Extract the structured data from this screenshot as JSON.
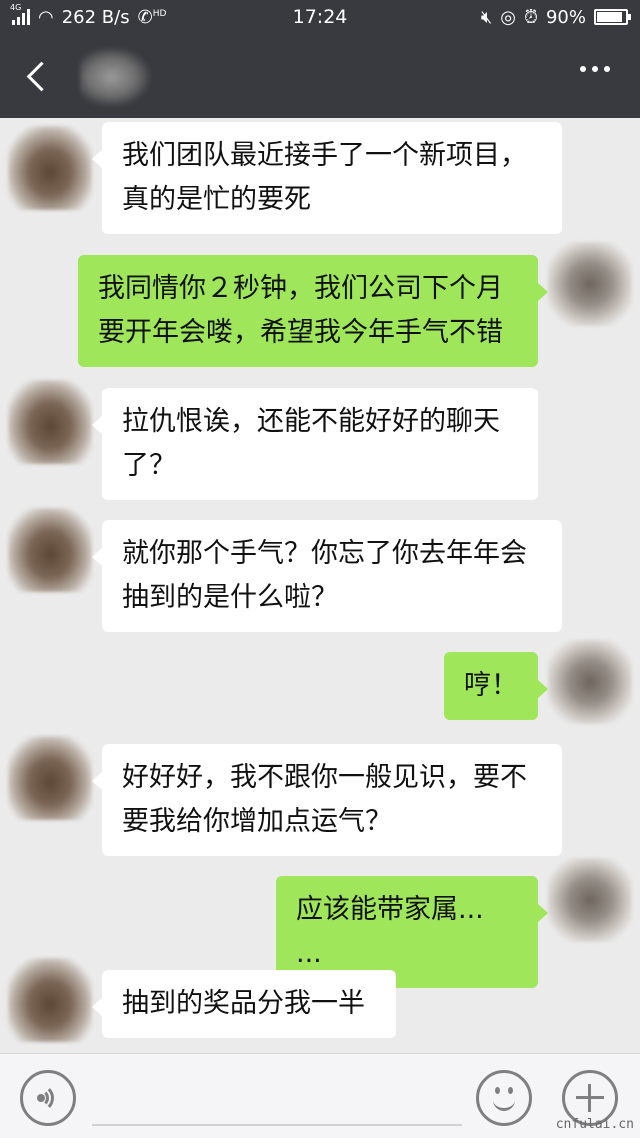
{
  "status_bar": {
    "network_type": "4G",
    "speed": "262 B/s",
    "hd_tag": "HD",
    "time": "17:24",
    "battery_percent": "90%",
    "battery_level": 0.9
  },
  "nav": {
    "back_icon": "chevron-left-icon",
    "more_icon": "ellipsis-icon"
  },
  "messages": [
    {
      "sender": "them",
      "lines": [
        "我们团队最近接手了一个新项目，",
        "真的是忙的要死"
      ]
    },
    {
      "sender": "me",
      "lines": [
        "我同情你２秒钟，我们公司下个月",
        "要开年会喽，希望我今年手气不错"
      ]
    },
    {
      "sender": "them",
      "lines": [
        "拉仇恨诶，还能不能好好的聊天",
        "了？"
      ]
    },
    {
      "sender": "them",
      "lines": [
        "就你那个手气？你忘了你去年年会",
        "抽到的是什么啦？"
      ]
    },
    {
      "sender": "me",
      "lines": [
        "哼！"
      ]
    },
    {
      "sender": "them",
      "lines": [
        "好好好，我不跟你一般见识，要不",
        "要我给你增加点运气？"
      ]
    },
    {
      "sender": "me",
      "lines": [
        "应该能带家属... ..."
      ]
    },
    {
      "sender": "them",
      "lines": [
        "抽到的奖品分我一半"
      ]
    }
  ],
  "input_bar": {
    "voice_icon": "voice-icon",
    "emoji_icon": "emoji-icon",
    "plus_icon": "plus-icon"
  },
  "watermark": "cnfulai.cn",
  "colors": {
    "header_bg": "#393a3f",
    "chat_bg": "#ebebeb",
    "bubble_me": "#9fe65a",
    "bubble_them": "#ffffff"
  }
}
